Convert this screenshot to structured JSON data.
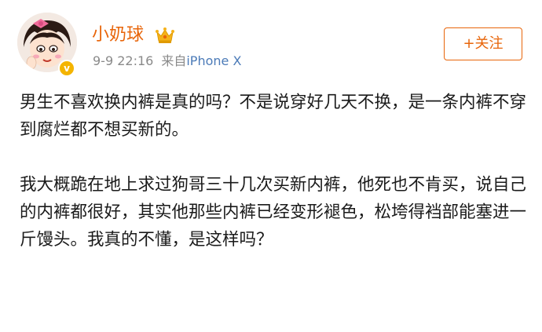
{
  "post": {
    "author": {
      "username": "小奶球",
      "avatar_icon": "cartoon-girl-avatar-with-pink-bow",
      "verified_badge": "v",
      "vip_icon": "crown-vip-icon"
    },
    "timestamp": "9-9 22:16",
    "source_label": "来自",
    "source_device": "iPhone X",
    "follow_label": "+关注",
    "paragraphs": [
      "男生不喜欢换内裤是真的吗？不是说穿好几天不换，是一条内裤不穿到腐烂都不想买新的。",
      "我大概跪在地上求过狗哥三十几次买新内裤，他死也不肯买，说自己的内裤都很好，其实他那些内裤已经变形褪色，松垮得裆部能塞进一斤馒头。我真的不懂，是这样吗？"
    ]
  },
  "colors": {
    "accent": "#e8650a",
    "link": "#4c7bb8",
    "meta_gray": "#8a8a8a",
    "text": "#1a1a1a",
    "badge_gold": "#f4b400"
  }
}
